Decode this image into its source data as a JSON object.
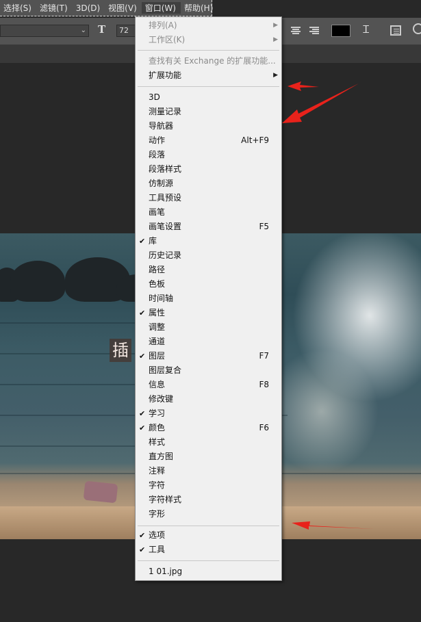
{
  "menubar": {
    "items": [
      "选择(S)",
      "滤镜(T)",
      "3D(D)",
      "视图(V)",
      "窗口(W)",
      "帮助(H)"
    ],
    "active_index": 4
  },
  "optionsbar": {
    "font_size": "72 点",
    "color_swatch": "#000000"
  },
  "image_text_glyph": "插",
  "window_menu": {
    "top_items": [
      {
        "label": "排列(A)",
        "submenu": true,
        "disabled": true
      },
      {
        "label": "工作区(K)",
        "submenu": true,
        "disabled": true
      },
      {
        "label": "查找有关 Exchange 的扩展功能...",
        "submenu": false,
        "disabled": true
      },
      {
        "label": "扩展功能",
        "submenu": true,
        "disabled": false
      }
    ],
    "panels": [
      {
        "label": "3D",
        "checked": false,
        "shortcut": ""
      },
      {
        "label": "测量记录",
        "checked": false,
        "shortcut": ""
      },
      {
        "label": "导航器",
        "checked": false,
        "shortcut": ""
      },
      {
        "label": "动作",
        "checked": false,
        "shortcut": "Alt+F9"
      },
      {
        "label": "段落",
        "checked": false,
        "shortcut": ""
      },
      {
        "label": "段落样式",
        "checked": false,
        "shortcut": ""
      },
      {
        "label": "仿制源",
        "checked": false,
        "shortcut": ""
      },
      {
        "label": "工具预设",
        "checked": false,
        "shortcut": ""
      },
      {
        "label": "画笔",
        "checked": false,
        "shortcut": ""
      },
      {
        "label": "画笔设置",
        "checked": false,
        "shortcut": "F5"
      },
      {
        "label": "库",
        "checked": true,
        "shortcut": ""
      },
      {
        "label": "历史记录",
        "checked": false,
        "shortcut": ""
      },
      {
        "label": "路径",
        "checked": false,
        "shortcut": ""
      },
      {
        "label": "色板",
        "checked": false,
        "shortcut": ""
      },
      {
        "label": "时间轴",
        "checked": false,
        "shortcut": ""
      },
      {
        "label": "属性",
        "checked": true,
        "shortcut": ""
      },
      {
        "label": "调整",
        "checked": false,
        "shortcut": ""
      },
      {
        "label": "通道",
        "checked": false,
        "shortcut": ""
      },
      {
        "label": "图层",
        "checked": true,
        "shortcut": "F7"
      },
      {
        "label": "图层复合",
        "checked": false,
        "shortcut": ""
      },
      {
        "label": "信息",
        "checked": false,
        "shortcut": "F8"
      },
      {
        "label": "修改键",
        "checked": false,
        "shortcut": ""
      },
      {
        "label": "学习",
        "checked": true,
        "shortcut": ""
      },
      {
        "label": "颜色",
        "checked": true,
        "shortcut": "F6"
      },
      {
        "label": "样式",
        "checked": false,
        "shortcut": ""
      },
      {
        "label": "直方图",
        "checked": false,
        "shortcut": ""
      },
      {
        "label": "注释",
        "checked": false,
        "shortcut": ""
      },
      {
        "label": "字符",
        "checked": false,
        "shortcut": ""
      },
      {
        "label": "字符样式",
        "checked": false,
        "shortcut": ""
      },
      {
        "label": "字形",
        "checked": false,
        "shortcut": ""
      }
    ],
    "bottom_items": [
      {
        "label": "选项",
        "checked": true
      },
      {
        "label": "工具",
        "checked": true
      }
    ],
    "documents": [
      {
        "label": "1 01.jpg"
      }
    ]
  },
  "colors": {
    "ui_bg": "#535353",
    "menu_bg": "#f0f0f0",
    "annotation_red": "#e8221b"
  }
}
